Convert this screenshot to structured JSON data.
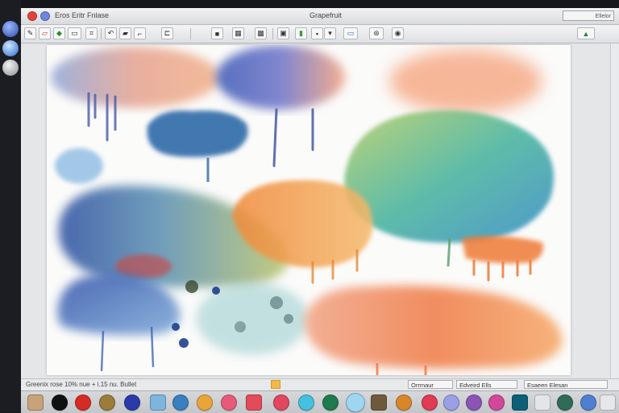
{
  "window": {
    "title": "Grapefruit",
    "app_menu": "Eros  Eritr  Fnlase",
    "title_right_label": "Ellelor"
  },
  "toolbar": {
    "tools": [
      "brush-icon",
      "eraser-icon",
      "fill-icon",
      "select-icon",
      "crop-icon",
      "lasso-icon",
      "hand-icon",
      "undo-icon",
      "layers-icon",
      "camera-icon",
      "film-icon",
      "picture-icon",
      "pencil-icon",
      "text-icon",
      "link-icon",
      "settings-icon",
      "landscape-icon",
      "globe-icon",
      "export-icon"
    ]
  },
  "status": {
    "left_text": "Greenix rose 10% nue + i.15 nu. Bullet",
    "box1": "Orrmaur",
    "box2": "Edveird Ells",
    "box3": "Esaeen Elesan"
  },
  "palette": {
    "swatches": [
      "#c9a27a",
      "#101010",
      "#d42b25",
      "#9b7c3a",
      "#2a3aa8",
      "#7fb4df",
      "#3a7fc0",
      "#e9a53a",
      "#e65a7a",
      "#e34a5a",
      "#e1475e",
      "#44c1df",
      "#1f7a4e",
      "#9ed6f2",
      "#6e5a3a",
      "#d9862a",
      "#e03a55",
      "#9aa0e6",
      "#8a55b4",
      "#d2479a",
      "#0d5f77",
      "#e3e6e8",
      "#2f6b57",
      "#4f7fd0",
      "#e7e7ea"
    ]
  },
  "colors": {
    "accent_red": "#e0443e",
    "accent_blue": "#4a72c8",
    "window_bg": "#dcdde0"
  }
}
